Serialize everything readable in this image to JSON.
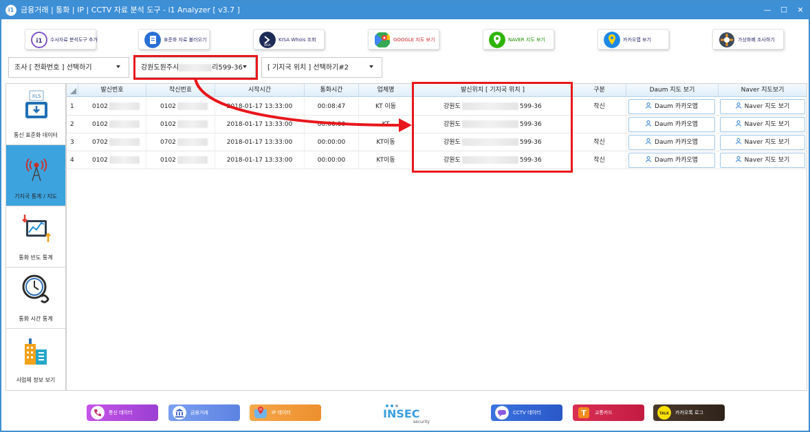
{
  "window": {
    "title": "금융거래 | 통화 | IP | CCTV 자료 분석 도구 - i1 Analyzer [ v3.7 ]",
    "app_icon_text": "i1",
    "minimize": "—",
    "maximize": "☐",
    "close": "✕"
  },
  "toolbar": [
    {
      "label": "수사자료 분석도구 추가",
      "icon": "plugin-icon",
      "color": "#7a4fc8"
    },
    {
      "label": "표준화 자료 불러오기",
      "icon": "document-icon",
      "color": "#2a6fd6"
    },
    {
      "label": "KISA Whois 조회",
      "icon": "kisa-icon",
      "color": "#1d2b57"
    },
    {
      "label": "GOOGLE 지도 보기",
      "icon": "google-maps-icon",
      "color": "#34a853"
    },
    {
      "label": "NAVER 지도 보기",
      "icon": "naver-map-icon",
      "color": "#2db400"
    },
    {
      "label": "카카오맵 보기",
      "icon": "kakao-map-icon",
      "color": "#1e88e5"
    },
    {
      "label": "가상화폐 조사하기",
      "icon": "crypto-icon",
      "color": "#3b4a5a"
    }
  ],
  "filters": {
    "investigation": "조사 [ 전화번호 ] 선택하기",
    "address_prefix": "강원도원주시",
    "address_suffix": "리599-36",
    "base_station": "[ 기지국 위치 ] 선택하기#2"
  },
  "sidebar": [
    {
      "label": "통신 표준화 데이터",
      "icon": "xls-download-icon"
    },
    {
      "label": "기지국 통계 / 지도",
      "icon": "cell-tower-icon",
      "active": true
    },
    {
      "label": "통화 빈도 통계",
      "icon": "call-frequency-chart-icon"
    },
    {
      "label": "통화 시간 통계",
      "icon": "call-time-clock-icon"
    },
    {
      "label": "사업체 정보 보기",
      "icon": "business-building-icon"
    }
  ],
  "table": {
    "headers": [
      "발신번호",
      "착신번호",
      "시작시간",
      "통화시간",
      "업체명",
      "발신위치 [ 기지국 위치 ]",
      "구분",
      "Daum 지도 보기",
      "Naver 지도보기"
    ],
    "rows": [
      {
        "no": "1",
        "caller": "0102",
        "callee": "0102",
        "start": "2018-01-17 13:33:00",
        "duration": "00:08:47",
        "carrier": "KT 이동",
        "location_prefix": "강원도",
        "location_suffix": "599-36",
        "type": "착신",
        "daum": "Daum 카카오맵",
        "naver": "Naver 지도 보기"
      },
      {
        "no": "2",
        "caller": "0102",
        "callee": "0102",
        "start": "2018-01-17 13:33:00",
        "duration": "00:00:00",
        "carrier": "KT",
        "location_prefix": "강원도",
        "location_suffix": "599-36",
        "type": "",
        "daum": "Daum 카카오맵",
        "naver": "Naver 지도 보기"
      },
      {
        "no": "3",
        "caller": "0702",
        "callee": "0702",
        "start": "2018-01-17 13:33:00",
        "duration": "00:00:00",
        "carrier": "KT이동",
        "location_prefix": "강원도",
        "location_suffix": "599-36",
        "type": "착신",
        "daum": "Daum 카카오맵",
        "naver": "Naver 지도 보기"
      },
      {
        "no": "4",
        "caller": "0102",
        "callee": "0102",
        "start": "2018-01-17 13:33:00",
        "duration": "00:00:00",
        "carrier": "KT이동",
        "location_prefix": "강원도",
        "location_suffix": "599-36",
        "type": "착신",
        "daum": "Daum 카카오맵",
        "naver": "Naver 지도 보기"
      }
    ]
  },
  "bottom_bar": [
    {
      "label": "통신 데이터",
      "icon": "phone-data-icon",
      "color": "#b04ad8"
    },
    {
      "label": "금융거래",
      "icon": "bank-icon",
      "color": "#6a8ee6"
    },
    {
      "label": "IP 데이터",
      "icon": "ip-map-icon",
      "color": "#f29a3a"
    },
    {
      "label": "CCTV 데이터",
      "icon": "cctv-chat-icon",
      "color": "#2c63d6"
    },
    {
      "label": "교통카드",
      "icon": "transit-card-icon",
      "color": "#d3234a"
    },
    {
      "label": "카카오톡 로그",
      "icon": "kakaotalk-icon",
      "color": "#3b2b1f"
    }
  ],
  "brand": {
    "name": "INSEC",
    "tagline": "security"
  },
  "colors": {
    "titlebar": "#3d8fd6",
    "highlight": "#e8161b",
    "active_nav": "#3da3de"
  }
}
